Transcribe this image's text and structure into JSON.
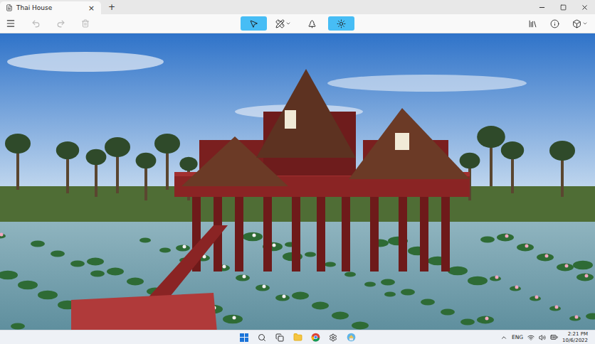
{
  "window": {
    "title": "Thai House",
    "tab_close": "×",
    "new_tab": "+"
  },
  "toolbar": {
    "undo": {
      "disabled": true
    },
    "redo": {
      "disabled": true
    },
    "delete": {
      "disabled": true
    },
    "tools": [
      {
        "kind": "select",
        "selected": true,
        "dropdown": false
      },
      {
        "kind": "build",
        "selected": false,
        "dropdown": true
      },
      {
        "kind": "landscape",
        "selected": false,
        "dropdown": false
      },
      {
        "kind": "lighting",
        "selected": true,
        "dropdown": false
      }
    ],
    "right": [
      {
        "kind": "library",
        "dropdown": false
      },
      {
        "kind": "info",
        "dropdown": false
      },
      {
        "kind": "view3d",
        "dropdown": true
      }
    ]
  },
  "taskbar": {
    "language": "ENG",
    "time": "2:21 PM",
    "date": "10/6/2022"
  }
}
